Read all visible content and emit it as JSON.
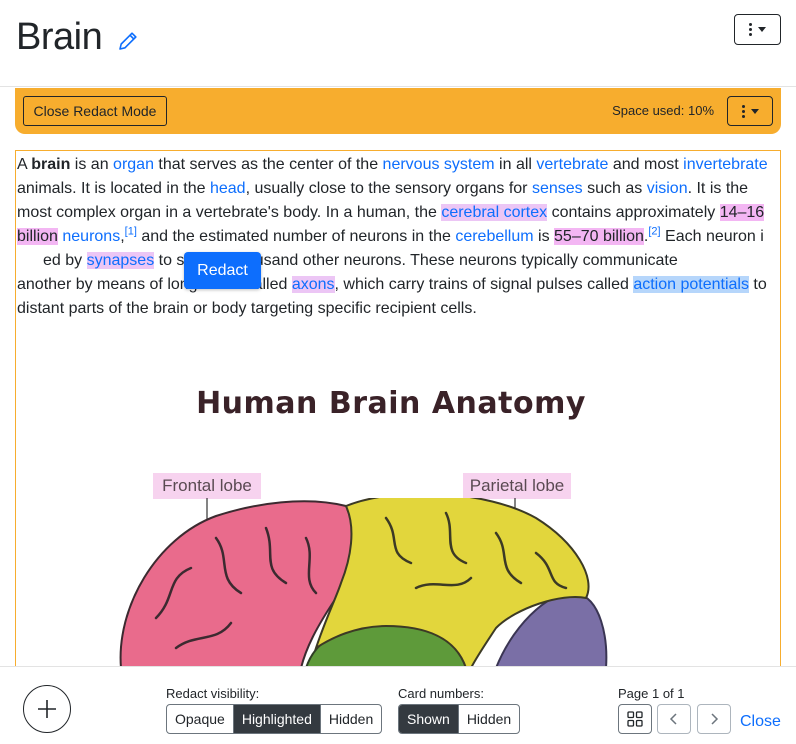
{
  "header": {
    "title": "Brain"
  },
  "redact_bar": {
    "close_label": "Close Redact Mode",
    "space_used": "Space used: 10%"
  },
  "article": {
    "p": [
      "A ",
      "brain",
      " is an ",
      "organ",
      " that serves as the center of the ",
      "nervous system",
      " in all ",
      "vertebrate",
      " and most ",
      "invertebrate",
      " animals. It is located in the ",
      "head",
      ", usually close to the sensory organs for ",
      "senses",
      " such as ",
      "vision",
      ". It is the most complex organ in a vertebrate's body. In a human, the ",
      "cerebral cortex",
      " contains approximately ",
      "14–16 billion",
      " ",
      "neurons",
      ",",
      "[1]",
      " and the estimated number of neurons in the ",
      "cerebellum",
      " is ",
      "55–70 billion",
      ".",
      "[2]",
      " Each neuron i",
      "ed by ",
      "synapses",
      " to several thousand other neurons. These neurons typically communicate ",
      "another by means of long fibers called ",
      "axons",
      ", which carry trains of signal pulses called ",
      "action potentials",
      " to distant parts of the brain or body targeting specific recipient cells."
    ]
  },
  "redact_popup": {
    "label": "Redact"
  },
  "diagram": {
    "title": "Human Brain Anatomy",
    "labels": [
      "Frontal lobe",
      "Parietal lobe"
    ]
  },
  "footer": {
    "visibility_label": "Redact visibility:",
    "visibility_options": [
      "Opaque",
      "Highlighted",
      "Hidden"
    ],
    "visibility_selected": "Highlighted",
    "card_label": "Card numbers:",
    "card_options": [
      "Shown",
      "Hidden"
    ],
    "card_selected": "Shown",
    "page_label": "Page 1 of 1",
    "close_label": "Close"
  },
  "colors": {
    "accent": "#f7ad2e",
    "link": "#0d6efd",
    "highlight": "#f3b6f3"
  }
}
